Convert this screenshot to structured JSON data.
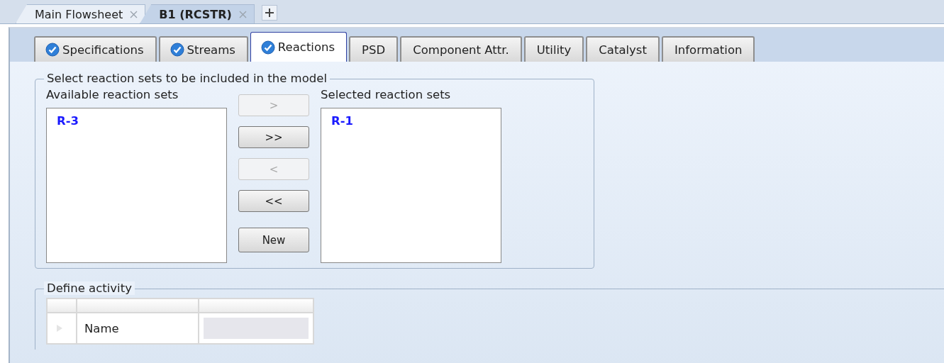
{
  "document_tabs": [
    {
      "label": "Main Flowsheet",
      "selected": false
    },
    {
      "label": "B1 (RCSTR)",
      "selected": true
    }
  ],
  "form_tabs": [
    {
      "label": "Specifications",
      "selected": false,
      "complete": true
    },
    {
      "label": "Streams",
      "selected": false,
      "complete": true
    },
    {
      "label": "Reactions",
      "selected": true,
      "complete": true
    },
    {
      "label": "PSD",
      "selected": false,
      "complete": false
    },
    {
      "label": "Component Attr.",
      "selected": false,
      "complete": false
    },
    {
      "label": "Utility",
      "selected": false,
      "complete": false
    },
    {
      "label": "Catalyst",
      "selected": false,
      "complete": false
    },
    {
      "label": "Information",
      "selected": false,
      "complete": false
    }
  ],
  "reaction_sets": {
    "title": "Select reaction sets to be included in the model",
    "available": {
      "label": "Available reaction sets",
      "items": [
        "R-3"
      ]
    },
    "selected": {
      "label": "Selected reaction sets",
      "items": [
        "R-1"
      ]
    },
    "buttons": [
      {
        "label": ">",
        "disabled": true
      },
      {
        "label": ">>",
        "disabled": false
      },
      {
        "label": "<",
        "disabled": true
      },
      {
        "label": "<<",
        "disabled": false
      },
      {
        "label": "New",
        "disabled": false
      }
    ]
  },
  "define_activity": {
    "title": "Define activity",
    "rows": [
      {
        "label": "Name",
        "disabled": true
      }
    ]
  }
}
